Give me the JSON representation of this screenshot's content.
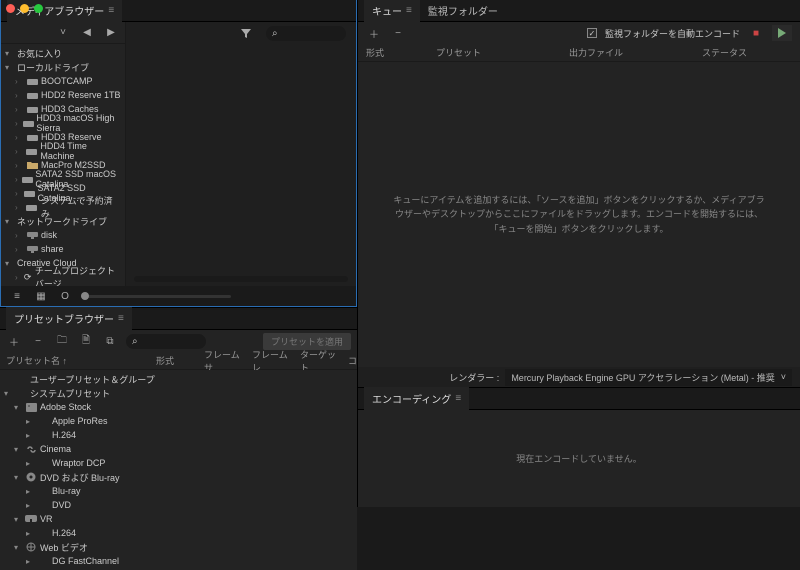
{
  "media_browser": {
    "tab_label": "メディアブラウザー",
    "nav_back_icon": "◀",
    "nav_fwd_icon": "▶",
    "filter_icon": "▼",
    "search_icon": "⌕",
    "tree": {
      "favorites": "お気に入り",
      "local_drives": "ローカルドライブ",
      "drives": [
        "BOOTCAMP",
        "HDD2 Reserve 1TB",
        "HDD3 Caches",
        "HDD3 macOS High Sierra",
        "HDD3 Reserve",
        "HDD4 Time Machine",
        "MacPro M2SSD",
        "SATA2 SSD macOS Catalina",
        "SATA2 SSD Catalina -…",
        "システムで予約済み"
      ],
      "network_drives": "ネットワークドライブ",
      "network_items": [
        "disk",
        "share"
      ],
      "creative_cloud": "Creative Cloud",
      "team_projects": "チームプロジェクトバージ…"
    },
    "footer": {
      "list_icon": "≡",
      "grid_icon": "▦",
      "thumb_icon": "O"
    }
  },
  "preset_browser": {
    "tab_label": "プリセットブラウザー",
    "add_icon": "＋",
    "del_icon": "−",
    "new_folder_icon": "🗀",
    "settings_icon": "🗎",
    "dup_icon": "⧉",
    "search_icon": "⌕",
    "apply_label": "プリセットを適用",
    "columns": {
      "name": "プリセット名 ↑",
      "format": "形式",
      "frame_size": "フレームサ…",
      "frame_rate": "フレームレ…",
      "target": "ターゲット…",
      "comment": "コメント"
    },
    "groups": {
      "user": "ユーザープリセット＆グループ",
      "system": "システムプリセット",
      "items": [
        {
          "label": "Adobe Stock",
          "icon": "image",
          "children": [
            "Apple ProRes",
            "H.264"
          ]
        },
        {
          "label": "Cinema",
          "icon": "link",
          "children": [
            "Wraptor DCP"
          ]
        },
        {
          "label": "DVD および Blu-ray",
          "icon": "disc",
          "children": [
            "Blu-ray",
            "DVD"
          ]
        },
        {
          "label": "VR",
          "icon": "vr",
          "children": [
            "H.264"
          ]
        },
        {
          "label": "Web ビデオ",
          "icon": "web",
          "children": [
            "DG FastChannel"
          ]
        }
      ]
    }
  },
  "queue": {
    "tabs": [
      "キュー",
      "監視フォルダー"
    ],
    "add_icon": "＋",
    "del_icon": "−",
    "auto_encode_label": "監視フォルダーを自動エンコード",
    "auto_encode_checked": true,
    "columns": {
      "format": "形式",
      "preset": "プリセット",
      "output": "出力ファイル",
      "status": "ステータス"
    },
    "empty_text": "キューにアイテムを追加するには、「ソースを追加」ボタンをクリックするか、メディアブラウザーやデスクトップからここにファイルをドラッグします。エンコードを開始するには、「キューを開始」ボタンをクリックします。",
    "renderer_label": "レンダラー :",
    "renderer_value": "Mercury Playback Engine GPU アクセラレーション (Metal) - 推奨"
  },
  "encoding": {
    "tab_label": "エンコーディング",
    "empty_text": "現在エンコードしていません。"
  }
}
